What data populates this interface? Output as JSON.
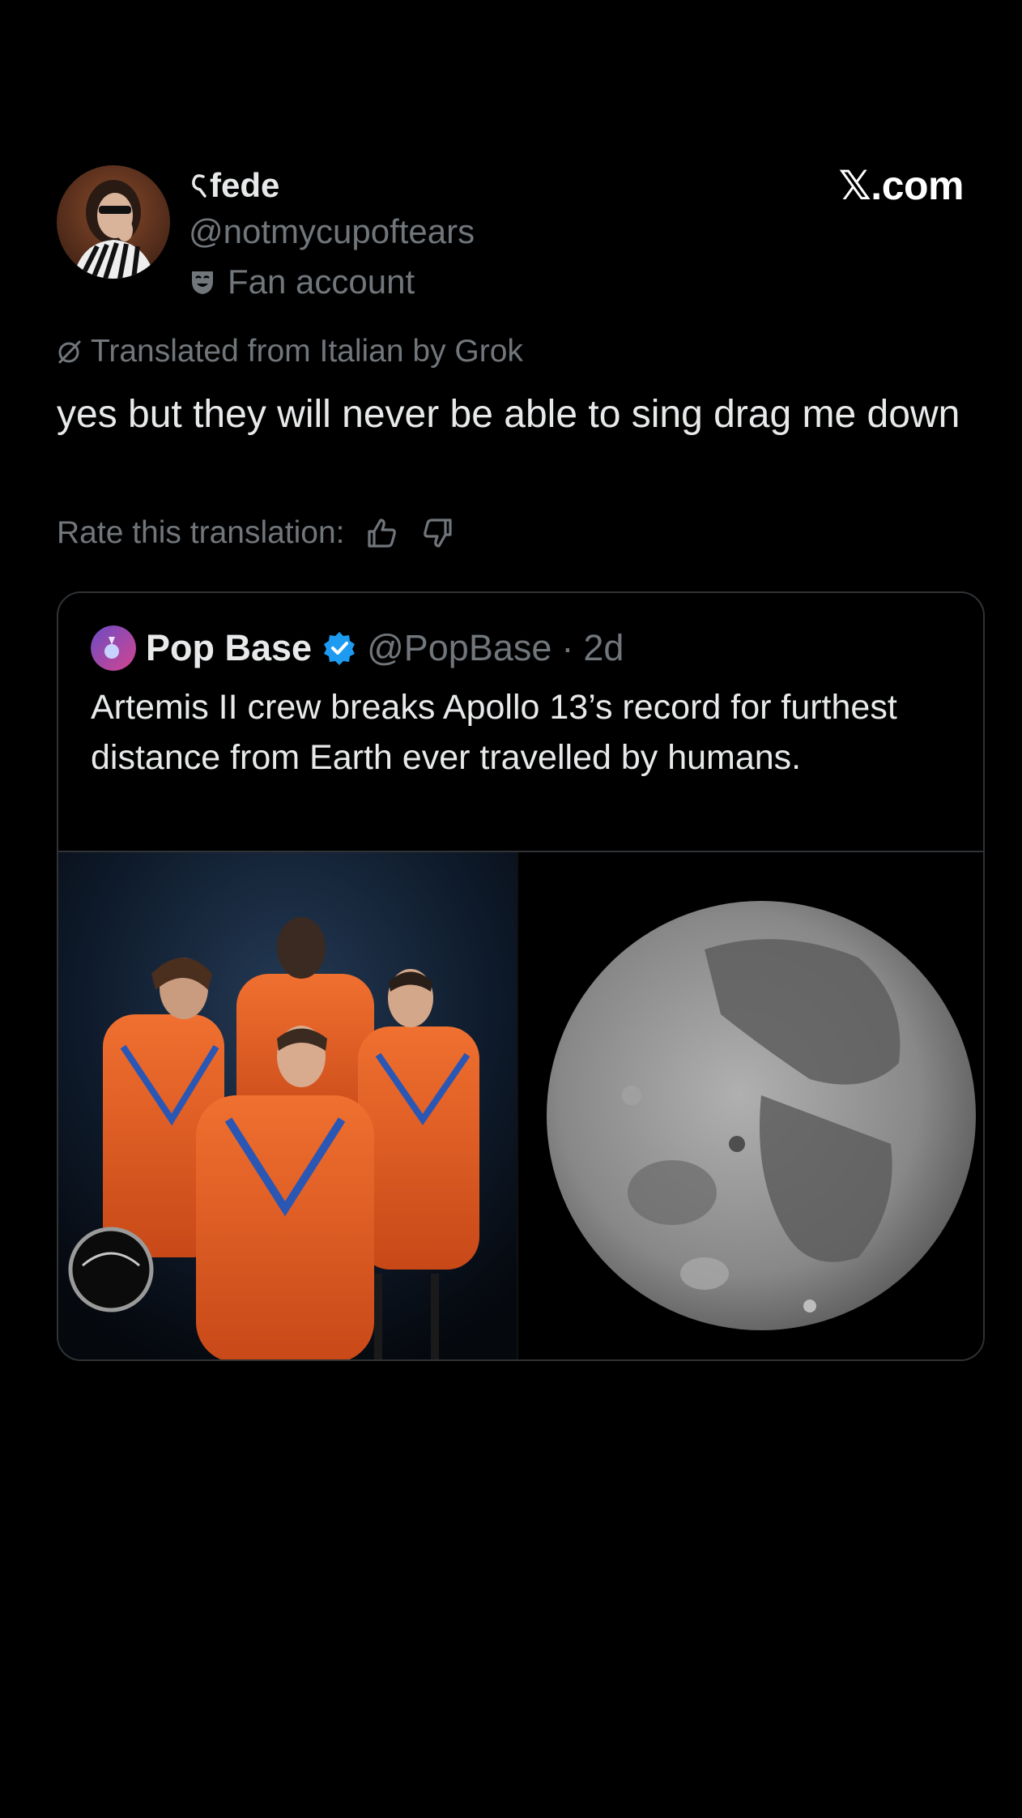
{
  "author": {
    "display_name": "fede",
    "handle": "@notmycupoftears",
    "badge_label": "Fan account"
  },
  "brand": {
    "label": "𝕏.com"
  },
  "translation": {
    "label": "Translated from Italian by Grok",
    "rate_label": "Rate this translation:"
  },
  "tweet": {
    "text": "yes but they will never be able to sing drag me down"
  },
  "quoted": {
    "name": "Pop Base",
    "handle": "@PopBase",
    "separator": "·",
    "time": "2d",
    "text": "Artemis II crew breaks Apollo 13’s record for furthest distance from Earth ever travelled by humans."
  },
  "colors": {
    "background": "#000000",
    "text_primary": "#e7e9ea",
    "text_secondary": "#71767b",
    "border": "#2f3336",
    "verified": "#1d9bf0"
  }
}
